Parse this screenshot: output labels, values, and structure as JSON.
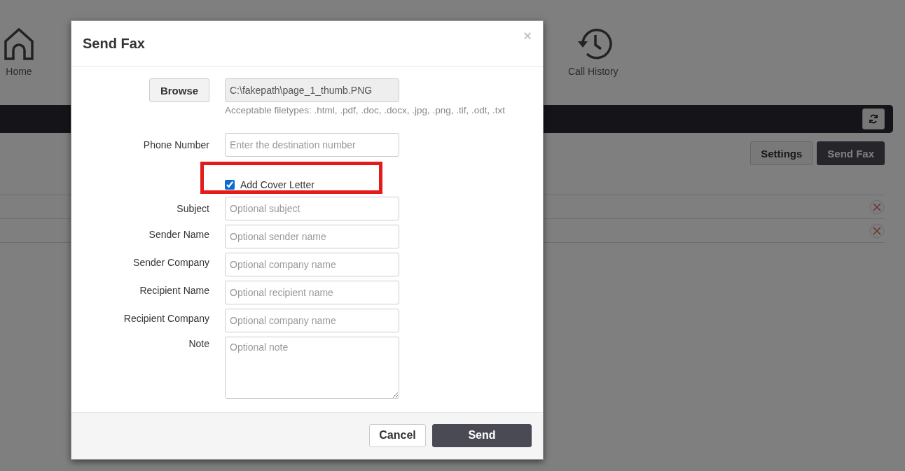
{
  "nav": [
    {
      "label": "Home",
      "kind": "home"
    },
    {
      "label": "Call History",
      "kind": "history"
    }
  ],
  "toolbar": {
    "refresh": true
  },
  "actions": [
    {
      "label": "Settings",
      "kind": "secondary"
    },
    {
      "label": "Send Fax",
      "kind": "primary"
    }
  ],
  "rows": [
    {
      "removable": true
    },
    {
      "removable": true
    }
  ],
  "dialog": {
    "title": "Send Fax",
    "close": "×",
    "file": {
      "button": "Browse",
      "value": "C:\\fakepath\\page_1_thumb.PNG",
      "hint": "Acceptable filetypes: .html, .pdf, .doc, .docx, .jpg, .png, .tif, .odt, .txt"
    },
    "phone": {
      "label": "Phone Number",
      "placeholder": "Enter the destination number"
    },
    "cover_letter": {
      "label": "Add Cover Letter",
      "checked": true,
      "highlighted": true
    },
    "fields": [
      {
        "label": "Subject",
        "placeholder": "Optional subject",
        "kind": "input"
      },
      {
        "label": "Sender Name",
        "placeholder": "Optional sender name",
        "kind": "input"
      },
      {
        "label": "Sender Company",
        "placeholder": "Optional company name",
        "kind": "input"
      },
      {
        "label": "Recipient Name",
        "placeholder": "Optional recipient name",
        "kind": "input"
      },
      {
        "label": "Recipient Company",
        "placeholder": "Optional company name",
        "kind": "input"
      },
      {
        "label": "Note",
        "placeholder": "Optional note",
        "kind": "textarea"
      }
    ],
    "buttons": [
      {
        "label": "Cancel",
        "kind": "secondary"
      },
      {
        "label": "Send",
        "kind": "primary"
      }
    ]
  }
}
